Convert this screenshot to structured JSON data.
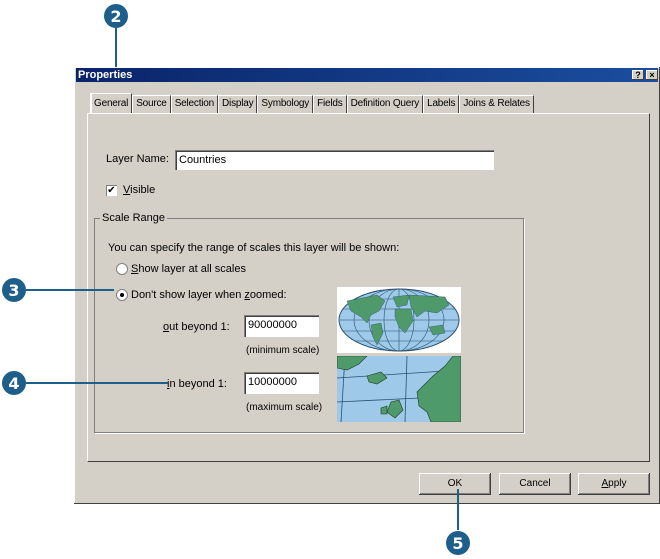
{
  "callouts": {
    "c2": "2",
    "c3": "3",
    "c4": "4",
    "c5": "5"
  },
  "window": {
    "title": "Properties",
    "help_btn": "?",
    "close_btn": "×"
  },
  "tabs": [
    "General",
    "Source",
    "Selection",
    "Display",
    "Symbology",
    "Fields",
    "Definition Query",
    "Labels",
    "Joins & Relates"
  ],
  "general": {
    "layer_name_label": "Layer Name:",
    "layer_name_value": "Countries",
    "visible_checked": "✔",
    "visible_label_u": "V",
    "visible_label_rest": "isible"
  },
  "scale_range": {
    "group_title": "Scale Range",
    "description": "You can specify the range of scales this layer will be shown:",
    "option_all_u": "S",
    "option_all_rest": "how layer at all scales",
    "option_zoom_pre": "Don't show layer when ",
    "option_zoom_u": "z",
    "option_zoom_rest": "oomed:",
    "out_beyond_u": "o",
    "out_beyond_rest": "ut beyond  1:",
    "out_beyond_value": "90000000",
    "minimum_scale": "(minimum scale)",
    "in_beyond_u": "i",
    "in_beyond_rest": "n beyond  1:",
    "in_beyond_value": "10000000",
    "maximum_scale": "(maximum scale)"
  },
  "buttons": {
    "ok": "OK",
    "cancel": "Cancel",
    "apply_u": "A",
    "apply_rest": "pply"
  },
  "colors": {
    "callout": "#1d5e8a",
    "dialog": "#d4d0c8",
    "titlebar": "#0a246a",
    "land": "#4f9a6a",
    "ocean": "#9ec9e8"
  }
}
